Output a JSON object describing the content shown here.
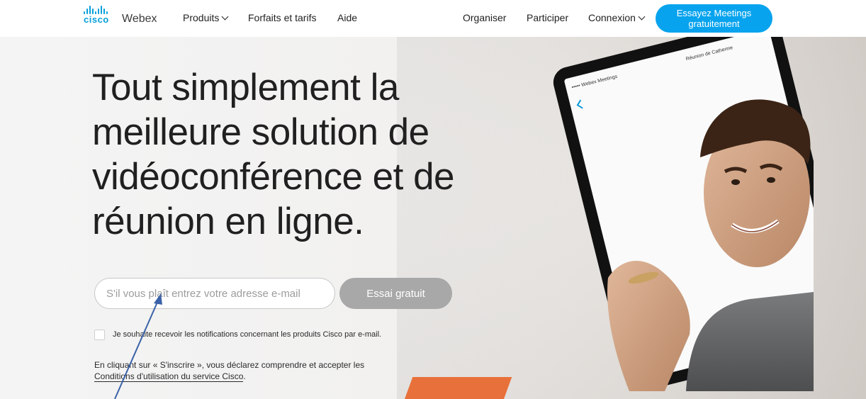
{
  "brand": {
    "cisco": "cisco",
    "product": "Webex",
    "accent_color": "#049fd9"
  },
  "nav": {
    "products": "Produits",
    "plans": "Forfaits et tarifs",
    "help": "Aide",
    "host": "Organiser",
    "join": "Participer",
    "login": "Connexion",
    "cta_line1": "Essayez Meetings",
    "cta_line2": "gratuitement",
    "cta_color": "#07a3ee"
  },
  "hero": {
    "headline": "Tout simplement la meilleure solution de vidéoconférence et de réunion en ligne.",
    "email_placeholder": "S'il vous plaît entrez votre adresse e-mail",
    "email_value": "",
    "trial_button": "Essai gratuit",
    "checkbox_label": "Je souhaite recevoir les notifications concernant les produits Cisco par e-mail.",
    "checkbox_checked": false,
    "legal_text": "En cliquant sur « S'inscrire », vous déclarez comprendre et accepter les",
    "legal_link": "Conditions d'utilisation du service Cisco",
    "legal_end": "."
  },
  "tablet": {
    "app_status": "••••• Webex Meetings",
    "meeting_title": "Réunion de Catherine",
    "back_icon": "chevron-left-icon"
  }
}
